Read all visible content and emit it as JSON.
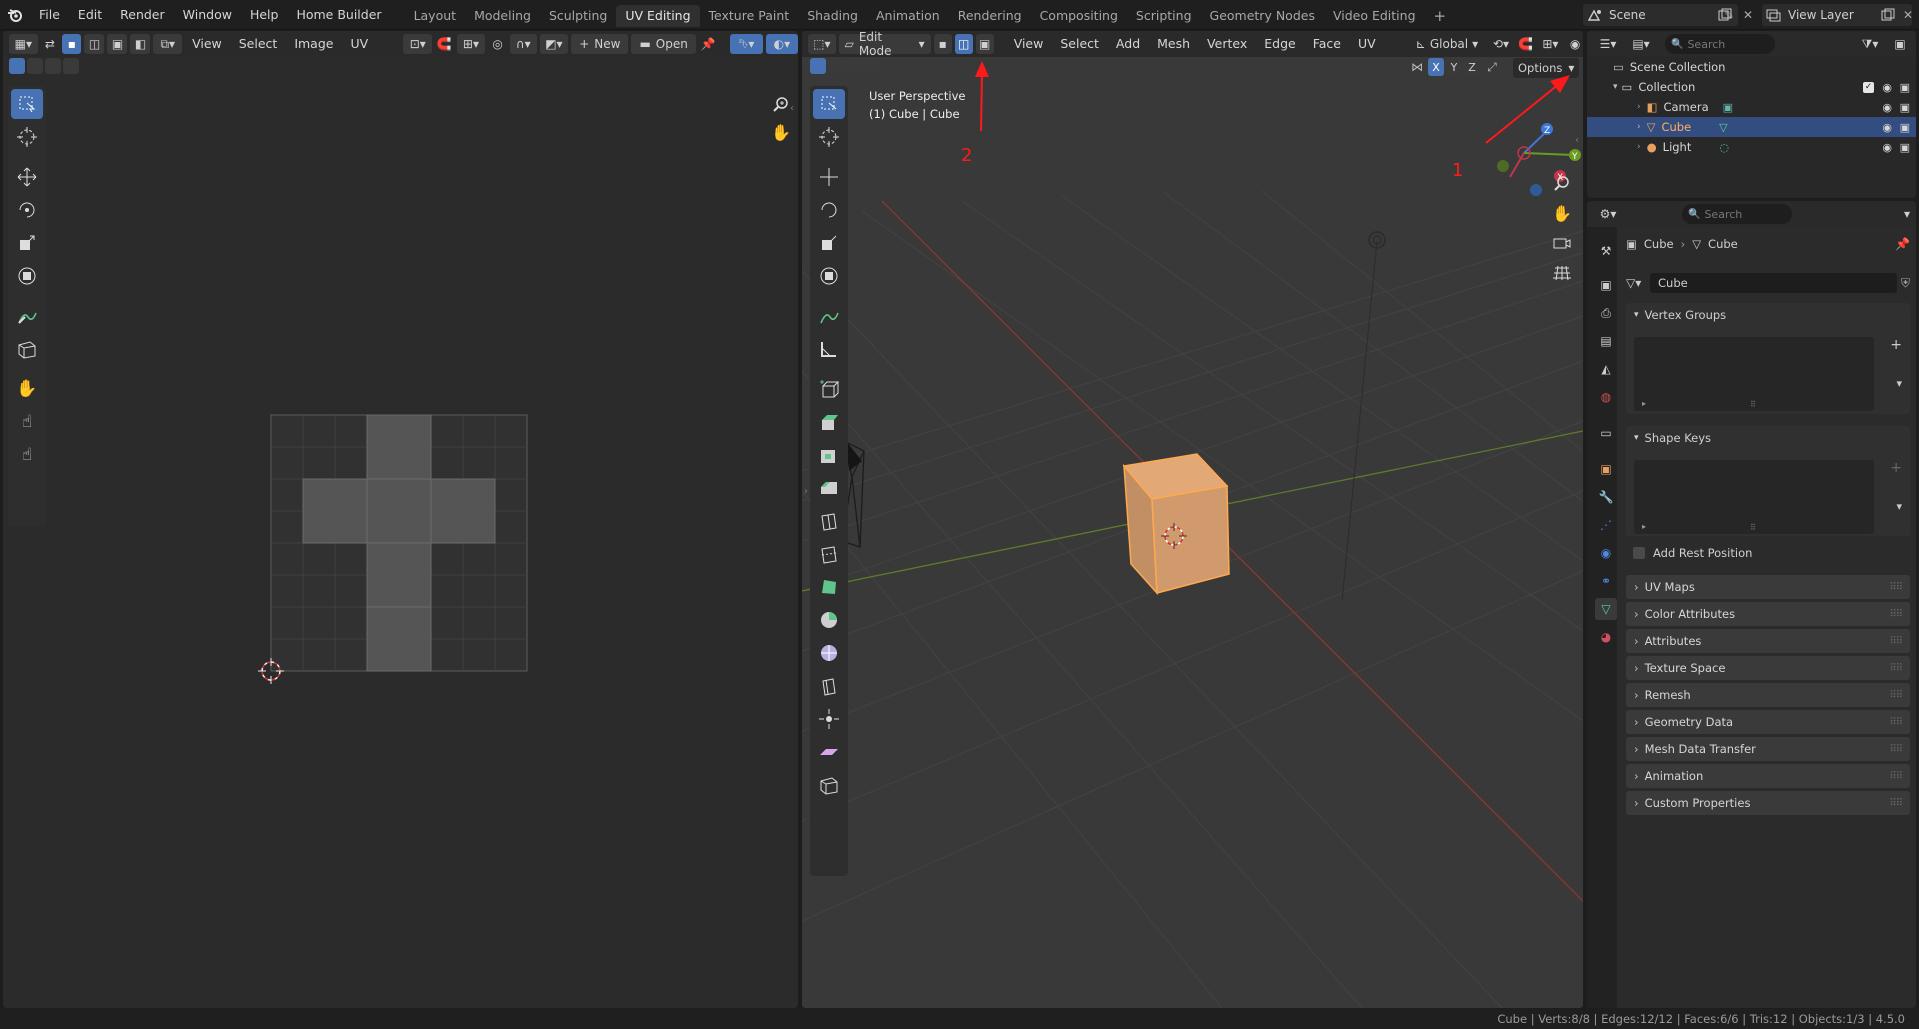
{
  "topbar": {
    "menus": [
      "File",
      "Edit",
      "Render",
      "Window",
      "Help",
      "Home Builder"
    ],
    "workspaces": [
      "Layout",
      "Modeling",
      "Sculpting",
      "UV Editing",
      "Texture Paint",
      "Shading",
      "Animation",
      "Rendering",
      "Compositing",
      "Scripting",
      "Geometry Nodes",
      "Video Editing"
    ],
    "active_workspace": "UV Editing",
    "add_tab": "+",
    "scene": "Scene",
    "view_layer": "View Layer"
  },
  "uv_editor": {
    "menus": [
      "View",
      "Select",
      "Image",
      "UV"
    ],
    "new_label": "New",
    "open_label": "Open"
  },
  "viewport": {
    "mode": "Edit Mode",
    "menus": [
      "View",
      "Select",
      "Add",
      "Mesh",
      "Vertex",
      "Edge",
      "Face",
      "UV"
    ],
    "orientation": "Global",
    "options_label": "Options",
    "overlay_title": "User Perspective",
    "overlay_sub": "(1) Cube | Cube",
    "axis_toggles": [
      "X",
      "Y",
      "Z"
    ],
    "annotation_1": "1",
    "annotation_2": "2",
    "annotation_color": "#ff1a1a"
  },
  "outliner": {
    "search_placeholder": "Search",
    "scene_collection": "Scene Collection",
    "collection": "Collection",
    "items": [
      {
        "label": "Camera",
        "selected": false
      },
      {
        "label": "Cube",
        "selected": true
      },
      {
        "label": "Light",
        "selected": false
      }
    ]
  },
  "properties": {
    "search_placeholder": "Search",
    "breadcrumb_object": "Cube",
    "breadcrumb_data": "Cube",
    "mesh_name": "Cube",
    "panels": {
      "vertex_groups": "Vertex Groups",
      "shape_keys": "Shape Keys",
      "add_rest_position": "Add Rest Position",
      "uv_maps": "UV Maps",
      "color_attributes": "Color Attributes",
      "attributes": "Attributes",
      "texture_space": "Texture Space",
      "remesh": "Remesh",
      "geometry_data": "Geometry Data",
      "mesh_data_transfer": "Mesh Data Transfer",
      "animation": "Animation",
      "custom_properties": "Custom Properties"
    }
  },
  "statusbar": {
    "text": "Cube | Verts:8/8 | Edges:12/12 | Faces:6/6 | Tris:12 | Objects:1/3 | 4.5.0"
  },
  "colors": {
    "accent": "#4772b3",
    "selected_object": "#ffa94d",
    "x_axis": "#c4344a",
    "y_axis": "#6b9c22",
    "z_axis": "#3d78d8"
  }
}
